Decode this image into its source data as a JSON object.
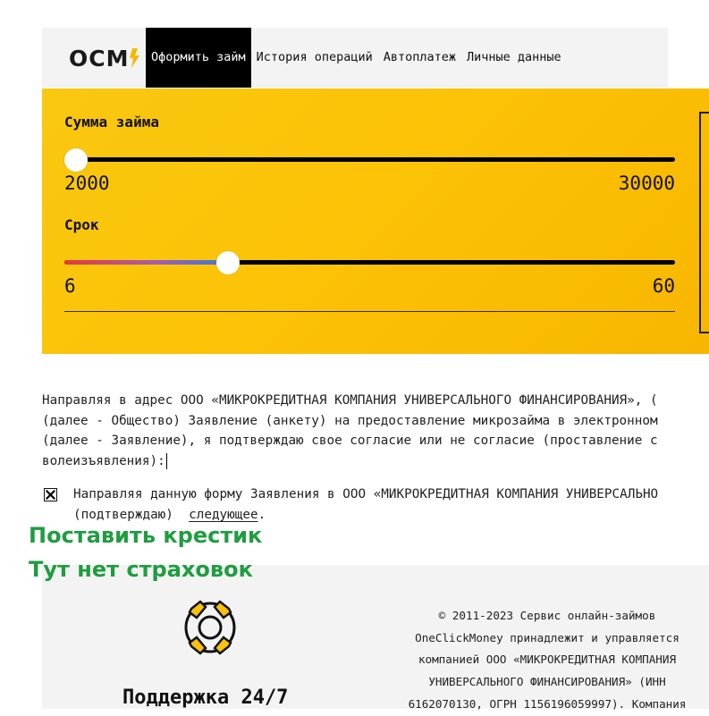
{
  "logo": {
    "text": "OCM"
  },
  "nav": [
    {
      "label": "Оформить займ",
      "active": true
    },
    {
      "label": "История операций"
    },
    {
      "label": "Автоплатеж"
    },
    {
      "label": "Личные данные"
    }
  ],
  "calculator": {
    "amount": {
      "label": "Сумма займа",
      "min": "2000",
      "max": "30000",
      "value": 2000
    },
    "term": {
      "label": "Срок",
      "min": "6",
      "max": "60",
      "value": 20
    }
  },
  "agreement": {
    "lines": [
      "Направляя в адрес ООО «МИКРОКРЕДИТНАЯ КОМПАНИЯ УНИВЕРСАЛЬНОГО ФИНАНСИРОВАНИЯ», (",
      "(далее - Общество) Заявление (анкету) на предоставление микрозайма в электронном",
      "(далее - Заявление), я подтверждаю свое согласие или не согласие (проставление с",
      "волеизъявления):"
    ],
    "checkbox_mark": "✕",
    "consent_line1": "Направляя данную форму Заявления в ООО «МИКРОКРЕДИТНАЯ КОМПАНИЯ УНИВЕРСАЛЬНО",
    "consent_line2_prefix": "(подтверждаю)  ",
    "consent_link": "следующее",
    "consent_line2_suffix": "."
  },
  "annotations": {
    "line1": "Поставить крестик",
    "line2": "Тут нет страховок"
  },
  "footer": {
    "support_title": "Поддержка 24/7",
    "copyright_lines": [
      "© 2011-2023 Сервис онлайн-займов",
      "OneClickMoney принадлежит и управляется",
      "компанией ООО «МИКРОКРЕДИТНАЯ КОМПАНИЯ",
      "УНИВЕРСАЛЬНОГО ФИНАНСИРОВАНИЯ» (ИНН",
      "6162070130, ОГРН 1156196059997). Компания"
    ]
  },
  "colors": {
    "brand_yellow": "#fcc307",
    "annotation_green": "#1f9d40",
    "nav_active_bg": "#000000"
  }
}
